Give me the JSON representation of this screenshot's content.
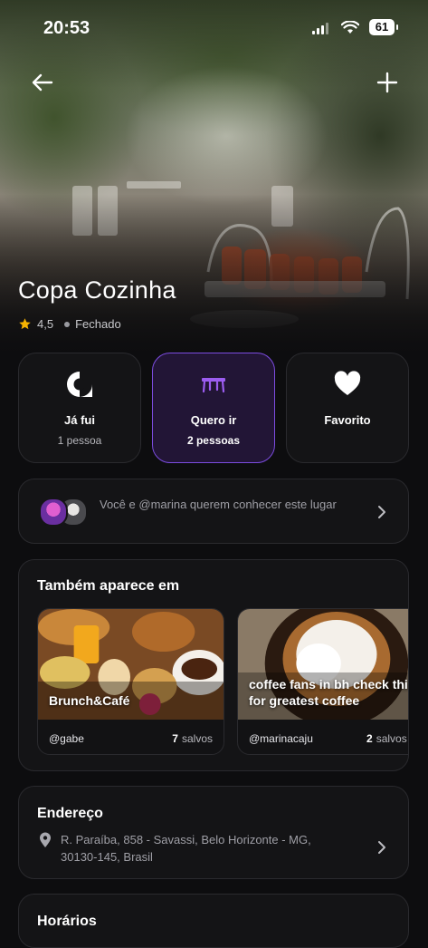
{
  "status": {
    "time": "20:53",
    "battery": "61"
  },
  "place": {
    "name": "Copa Cozinha",
    "rating": "4,5",
    "status": "Fechado"
  },
  "actions": [
    {
      "label": "Já fui",
      "sub": "1 pessoa"
    },
    {
      "label": "Quero ir",
      "sub": "2 pessoas"
    },
    {
      "label": "Favorito",
      "sub": ""
    }
  ],
  "friends": {
    "text": "Você e @marina querem conhecer este lugar"
  },
  "lists": {
    "title": "Também aparece em",
    "items": [
      {
        "name": "Brunch&Café",
        "user": "@gabe",
        "count": "7",
        "count_label": "salvos"
      },
      {
        "name": "coffee fans in bh check this out for greatest coffee",
        "user": "@marinacaju",
        "count": "2",
        "count_label": "salvos"
      }
    ]
  },
  "address": {
    "title": "Endereço",
    "text": "R. Paraíba, 858 - Savassi, Belo Horizonte - MG, 30130-145, Brasil"
  },
  "hours": {
    "title": "Horários"
  },
  "colors": {
    "accent": "#7c4ce0",
    "star": "#f5b301"
  }
}
